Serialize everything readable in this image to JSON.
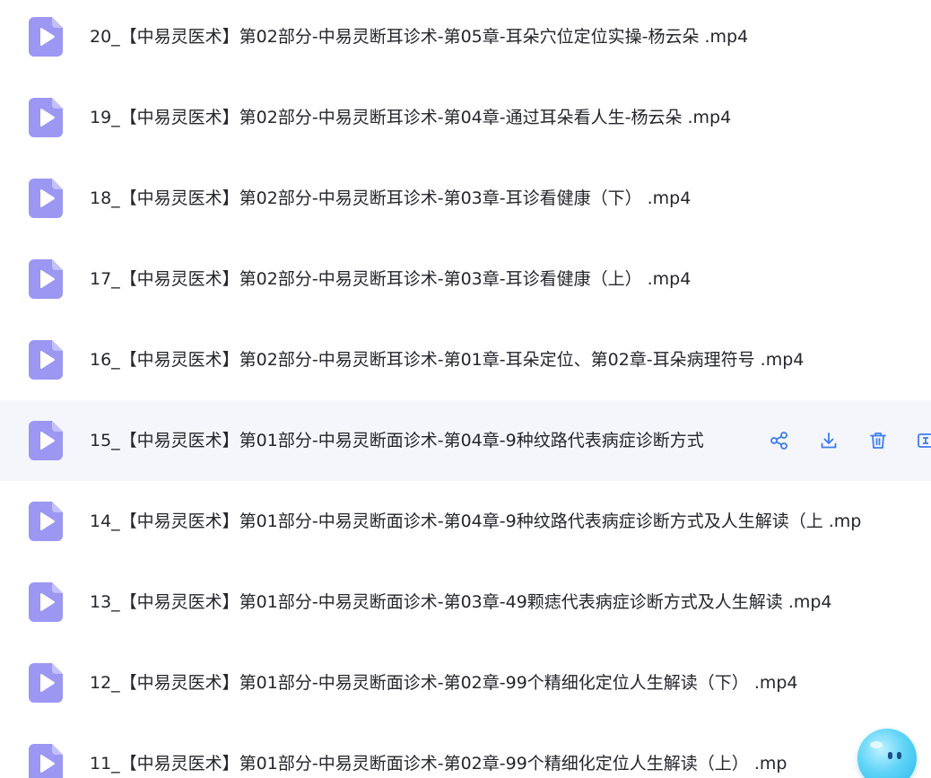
{
  "files": [
    {
      "name": "20_【中易灵医术】第02部分-中易灵断耳诊术-第05章-耳朵穴位定位实操-杨云朵 .mp4",
      "icon": "video-file-icon"
    },
    {
      "name": "19_【中易灵医术】第02部分-中易灵断耳诊术-第04章-通过耳朵看人生-杨云朵 .mp4",
      "icon": "video-file-icon"
    },
    {
      "name": "18_【中易灵医术】第02部分-中易灵断耳诊术-第03章-耳诊看健康（下） .mp4",
      "icon": "video-file-icon"
    },
    {
      "name": "17_【中易灵医术】第02部分-中易灵断耳诊术-第03章-耳诊看健康（上） .mp4",
      "icon": "video-file-icon"
    },
    {
      "name": "16_【中易灵医术】第02部分-中易灵断耳诊术-第01章-耳朵定位、第02章-耳朵病理符号 .mp4",
      "icon": "video-file-icon"
    },
    {
      "name": "15_【中易灵医术】第01部分-中易灵断面诊术-第04章-9种纹路代表病症诊断方式",
      "icon": "video-file-icon",
      "hovered": true
    },
    {
      "name": "14_【中易灵医术】第01部分-中易灵断面诊术-第04章-9种纹路代表病症诊断方式及人生解读（上 .mp",
      "icon": "video-file-icon"
    },
    {
      "name": "13_【中易灵医术】第01部分-中易灵断面诊术-第03章-49颗痣代表病症诊断方式及人生解读 .mp4",
      "icon": "video-file-icon"
    },
    {
      "name": "12_【中易灵医术】第01部分-中易灵断面诊术-第02章-99个精细化定位人生解读（下） .mp4",
      "icon": "video-file-icon"
    },
    {
      "name": "11_【中易灵医术】第01部分-中易灵断面诊术-第02章-99个精细化定位人生解读（上） .mp",
      "icon": "video-file-icon"
    }
  ],
  "row_actions": [
    "share-icon",
    "download-icon",
    "delete-icon",
    "more-icon"
  ],
  "colors": {
    "icon_fill": "#9b97f3",
    "icon_play": "#ffffff",
    "action_blue": "#3d7cf0",
    "hover_bg": "#f4f6fb",
    "text": "#25262b"
  },
  "assistant_icon": "assistant-bot-icon"
}
